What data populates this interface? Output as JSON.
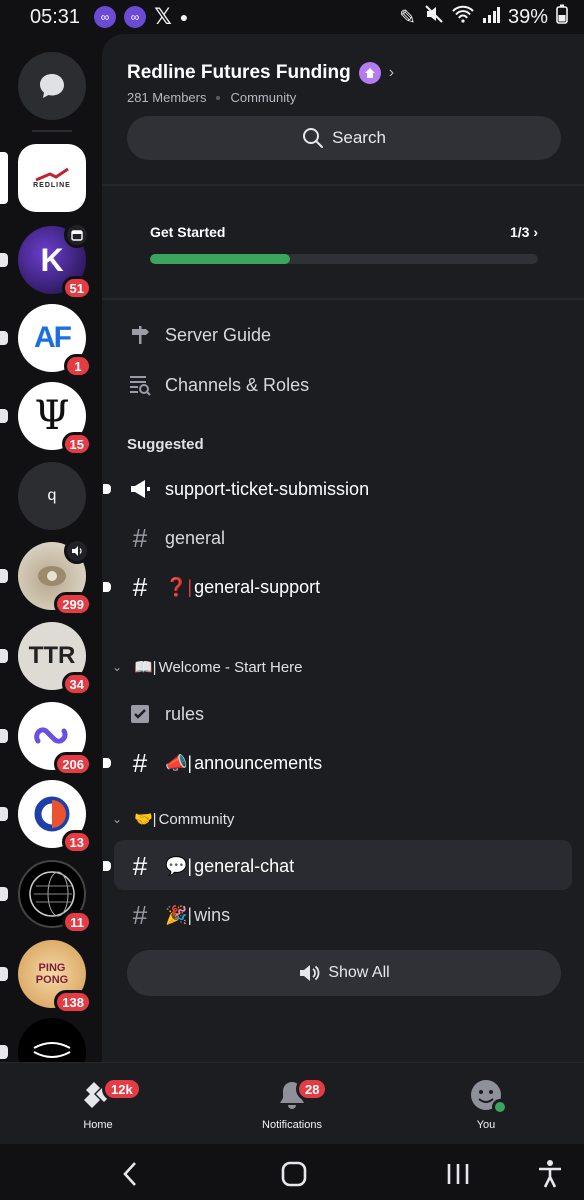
{
  "status_bar": {
    "time": "05:31",
    "battery": "39%"
  },
  "rail": {
    "servers": [
      {
        "name": "Redline",
        "text": "REDLINE",
        "selected": true
      },
      {
        "name": "KK server",
        "text": "K",
        "badge": "51",
        "event": true
      },
      {
        "name": "AF server",
        "text": "AF",
        "badge": "1"
      },
      {
        "name": "Psi server",
        "text": "Ψ",
        "badge": "15"
      },
      {
        "name": "q server",
        "text": "q"
      },
      {
        "name": "Speaker server",
        "badge": "299",
        "voice": true
      },
      {
        "name": "TTR server",
        "text": "TTR",
        "badge": "34"
      },
      {
        "name": "Link server",
        "badge": "206"
      },
      {
        "name": "Circle server",
        "badge": "13"
      },
      {
        "name": "Globe server",
        "badge": "11"
      },
      {
        "name": "Ping Pong server",
        "text": "PING PONG",
        "badge": "138"
      },
      {
        "name": "Wave server"
      }
    ]
  },
  "server": {
    "title": "Redline Futures Funding",
    "members": "281 Members",
    "type": "Community",
    "search_label": "Search"
  },
  "get_started": {
    "label": "Get Started",
    "progress_text": "1/3",
    "progress": 0.36
  },
  "links": {
    "server_guide": "Server Guide",
    "channels_roles": "Channels & Roles"
  },
  "suggested": {
    "label": "Suggested",
    "channels": [
      {
        "name": "support-ticket-submission",
        "unread": true
      },
      {
        "name": "general",
        "unread": false
      },
      {
        "name": "general-support",
        "prefix": "❓|",
        "unread": true
      }
    ]
  },
  "categories": [
    {
      "title": "Welcome - Start Here",
      "prefix": "📖|",
      "channels": [
        {
          "name": "rules"
        },
        {
          "name": "announcements",
          "prefix": "📣|",
          "unread": true
        }
      ]
    },
    {
      "title": "Community",
      "prefix": "🤝|",
      "channels": [
        {
          "name": "general-chat",
          "prefix": "💬|",
          "unread": true,
          "selected": true
        },
        {
          "name": "wins",
          "prefix": "🎉|"
        }
      ]
    }
  ],
  "show_all": "Show All",
  "bottom_nav": {
    "home": {
      "label": "Home",
      "badge": "12k"
    },
    "notifications": {
      "label": "Notifications",
      "badge": "28"
    },
    "you": {
      "label": "You"
    }
  },
  "colors": {
    "accent_green": "#3ba55d",
    "badge_red": "#e33c45",
    "boost_purple": "#b47cf0"
  }
}
